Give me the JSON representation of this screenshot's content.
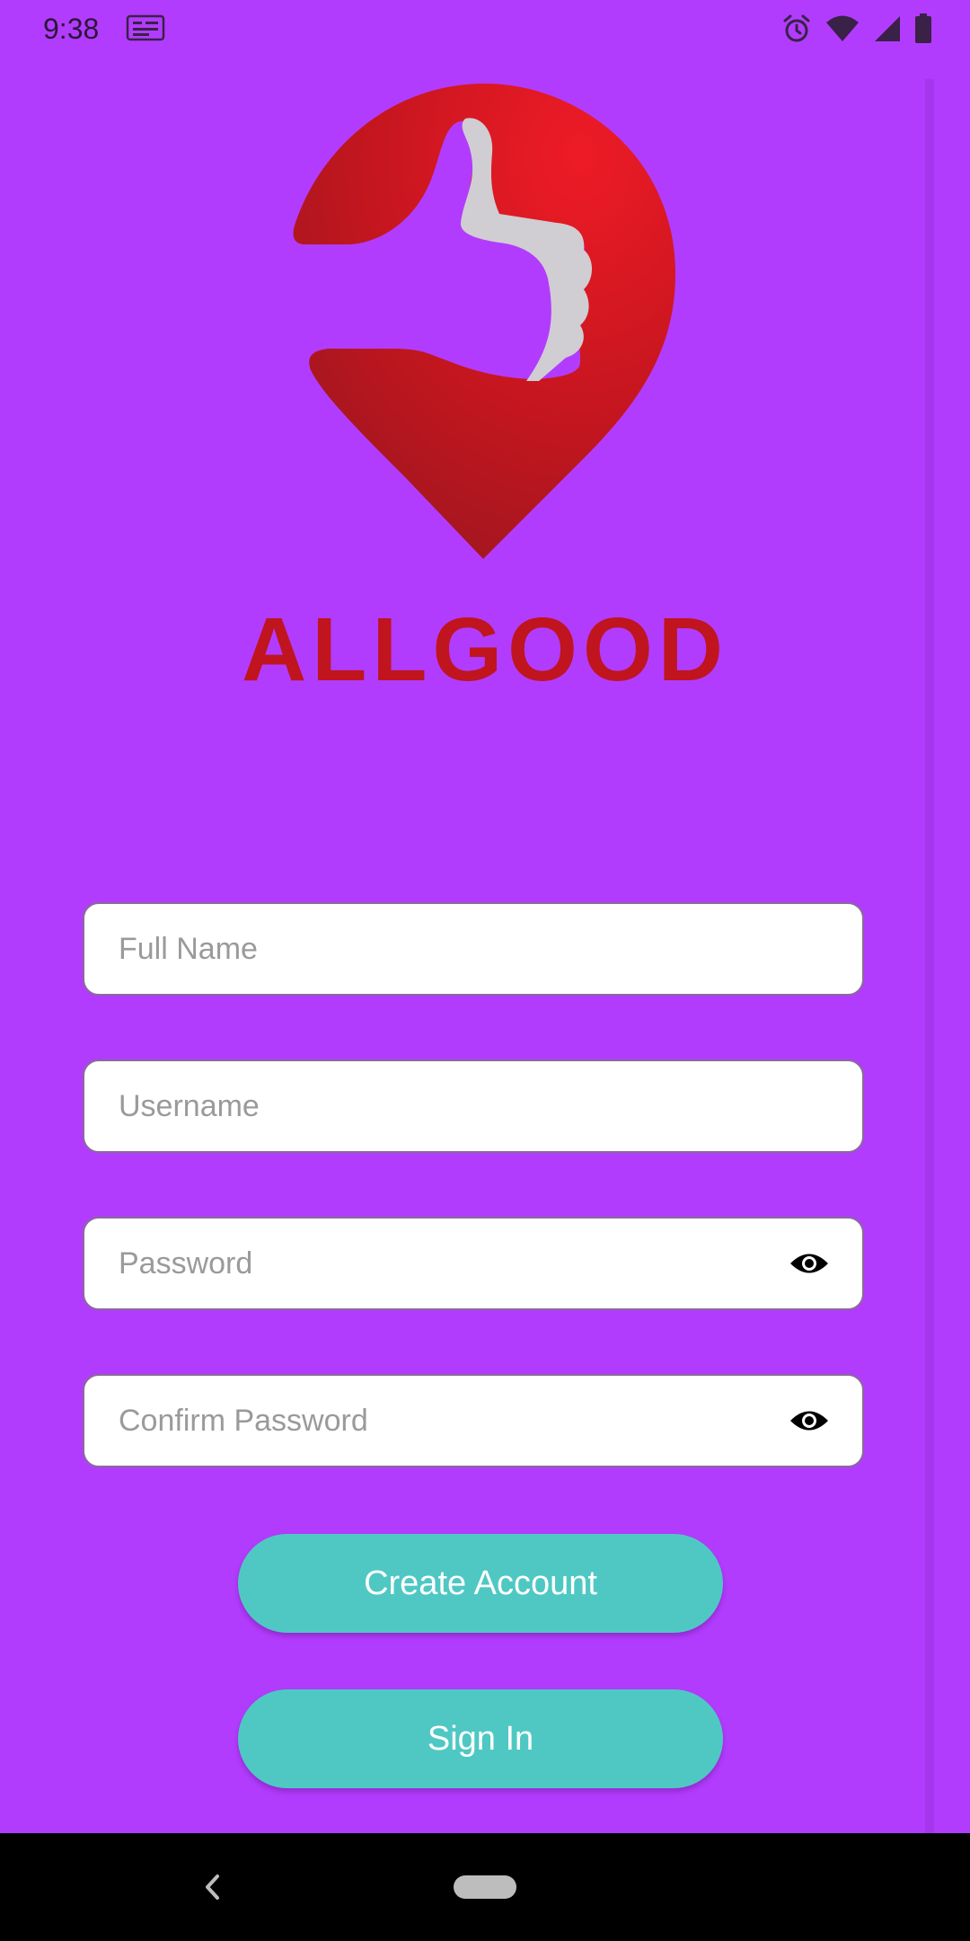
{
  "status_bar": {
    "time": "9:38"
  },
  "brand": {
    "name": "ALLGOOD",
    "primary_color": "#c0141f",
    "background_color": "#b23cfd"
  },
  "form": {
    "full_name": {
      "placeholder": "Full Name",
      "value": ""
    },
    "username": {
      "placeholder": "Username",
      "value": ""
    },
    "password": {
      "placeholder": "Password",
      "value": "",
      "toggle_icon": "eye-icon"
    },
    "confirm_password": {
      "placeholder": "Confirm Password",
      "value": "",
      "toggle_icon": "eye-icon"
    }
  },
  "buttons": {
    "create_account": "Create Account",
    "sign_in": "Sign In",
    "color": "#4fc8c4"
  },
  "icons": {
    "status_left": [
      "notification-icon"
    ],
    "status_right": [
      "alarm-icon",
      "wifi-icon",
      "signal-icon",
      "battery-icon"
    ],
    "navigation": [
      "back-icon",
      "home-pill"
    ]
  }
}
